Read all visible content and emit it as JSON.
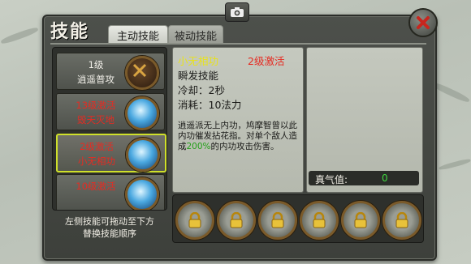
{
  "window": {
    "title": "技能"
  },
  "tabs": [
    {
      "label": "主动技能"
    },
    {
      "label": "被动技能"
    }
  ],
  "skill_list": [
    {
      "line1": "1级",
      "line2": "逍遥普攻",
      "color": "white",
      "orb": "dark",
      "selected": false
    },
    {
      "line1": "13级激活",
      "line2": "毁天灭地",
      "color": "red",
      "orb": "blue",
      "selected": false
    },
    {
      "line1": "2级激活",
      "line2": "小无相功",
      "color": "red",
      "orb": "blue",
      "selected": true
    },
    {
      "line1": "10级激活",
      "line2": "",
      "color": "red",
      "orb": "blue",
      "selected": false
    }
  ],
  "hint": {
    "line1": "左侧技能可拖动至下方",
    "line2": "替换技能顺序"
  },
  "detail": {
    "name": "小无相功",
    "activation": "2级激活",
    "type": "瞬发技能",
    "cooldown": "冷却：2秒",
    "cost": "消耗：10法力",
    "description_pre": "逍遥派无上内功，鸠摩智曾以此内功催发拈花指。对单个敌人造成",
    "description_pct": "200%",
    "description_post": "的内功攻击伤害。"
  },
  "qi": {
    "label": "真气值:",
    "value": "0"
  },
  "slots": [
    {
      "icon": "lock-icon"
    },
    {
      "icon": "lock-icon"
    },
    {
      "icon": "lock-icon"
    },
    {
      "icon": "lock-icon"
    },
    {
      "icon": "lock-icon"
    },
    {
      "icon": "lock-icon"
    }
  ],
  "colors": {
    "accent_red": "#e62b22",
    "accent_yellow": "#e8e21c",
    "accent_green": "#23a019",
    "selection": "#cfe02a"
  }
}
